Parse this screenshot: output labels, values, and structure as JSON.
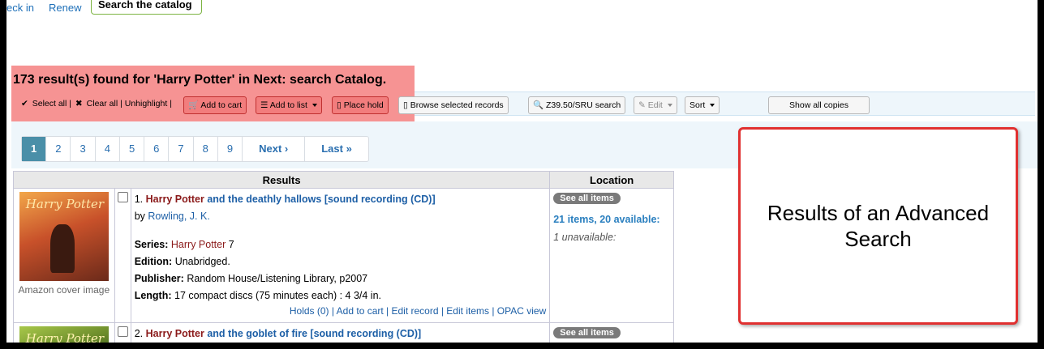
{
  "topnav": {
    "check_in": "eck in",
    "renew": "Renew",
    "search_catalog": "Search the catalog"
  },
  "results_header": "173 result(s) found for 'Harry Potter' in Next: search Catalog.",
  "toolbar": {
    "select_all": "Select all",
    "clear_all": "Clear all",
    "unhighlight": "| Unhighlight |",
    "sep": "|",
    "add_to_cart": "Add to cart",
    "add_to_list": "Add to list",
    "place_hold": "Place hold",
    "browse_selected": "Browse selected records",
    "z3950": "Z39.50/SRU search",
    "edit": "Edit",
    "sort": "Sort",
    "show_all_copies": "Show all copies"
  },
  "pagination": {
    "pages": [
      "1",
      "2",
      "3",
      "4",
      "5",
      "6",
      "7",
      "8",
      "9"
    ],
    "next": "Next ›",
    "last": "Last »",
    "current": "1"
  },
  "table": {
    "headers": {
      "results": "Results",
      "location": "Location"
    },
    "rows": [
      {
        "number": "1.",
        "title_highlight": "Harry Potter",
        "title_rest": " and the deathly hallows [sound recording (CD)]",
        "by_label": "by",
        "author": "Rowling, J. K.",
        "series_label": "Series:",
        "series": "Harry Potter",
        "series_num": "7",
        "edition_label": "Edition:",
        "edition": "Unabridged.",
        "publisher_label": "Publisher:",
        "publisher": "Random House/Listening Library, p2007",
        "length_label": "Length:",
        "length": "17 compact discs (75 minutes each) : 4 3/4 in.",
        "actions": "Holds (0) | Add to cart | Edit record | Edit items | OPAC view",
        "cover_caption": "Amazon cover image",
        "see_all": "See all items",
        "availability": "21 items, 20 available:",
        "unavailable": "1 unavailable:"
      },
      {
        "number": "2.",
        "title_highlight": "Harry Potter",
        "title_rest": " and the goblet of fire [sound recording (CD)]",
        "see_all": "See all items"
      }
    ]
  },
  "annotation": "Results of an Advanced Search",
  "colors": {
    "highlight": "#f58a8a",
    "link": "#1d5fa6",
    "title_highlight": "#8b1a1a",
    "active_page": "#4a8fa8",
    "annotation_border": "#e03030"
  },
  "icons": {
    "select_all": "check-icon",
    "clear_all": "x-icon",
    "cart": "cart-icon",
    "list": "list-icon",
    "hold": "bookmark-icon",
    "browse": "bookmark-icon",
    "z3950": "search-icon",
    "edit": "pencil-icon"
  }
}
